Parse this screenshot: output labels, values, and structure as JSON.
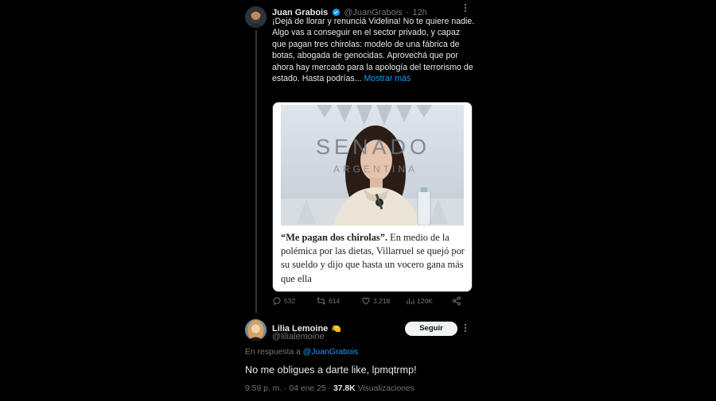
{
  "tweet": {
    "author_name": "Juan Grabois",
    "author_handle": "@JuanGrabois",
    "separator": "·",
    "time_ago": "12h",
    "text": "¡Dejá de llorar y renunciá Videlina! No te quiere nadie. Algo vas a conseguir en el sector privado, y capaz que pagan tres chirolas: modelo de una fábrica de botas, abogada de genocidas. Aprovechá que por ahora hay mercado para la apología del terrorismo de estado. Hasta podrías...",
    "show_more_label": "Mostrar más",
    "card": {
      "image_text_top": "SENADO",
      "image_text_bottom": "ARGENTINA",
      "caption_bold": "“Me pagan dos chirolas”.",
      "caption_rest": " En medio de la polémica por las dietas, Villarruel se quejó por su sueldo y dijo que hasta un vocero gana más que ella"
    },
    "actions": {
      "replies": "532",
      "retweets": "614",
      "likes": "3,218",
      "views": "120K"
    },
    "colors": {
      "link": "#1d9bf0",
      "verified": "#1d9bf0",
      "muted": "#71767b"
    },
    "icons": [
      "verified-badge-icon",
      "more-icon",
      "reply-icon",
      "retweet-icon",
      "like-icon",
      "views-icon",
      "share-icon"
    ]
  },
  "reply": {
    "author_name": "Lilia Lemoine",
    "author_emoji": "🍋",
    "author_handle": "@lilialemoine",
    "follow_label": "Seguir",
    "reply_to_prefix": "En respuesta a ",
    "reply_to_handle": "@JuanGrabois",
    "text": "No me obligues a darte like, lpmqtrmp!",
    "time": "9:59 p. m.",
    "separator": "·",
    "date": "04 ene 25",
    "views_count": "37.8K",
    "views_label": "Visualizaciones"
  }
}
